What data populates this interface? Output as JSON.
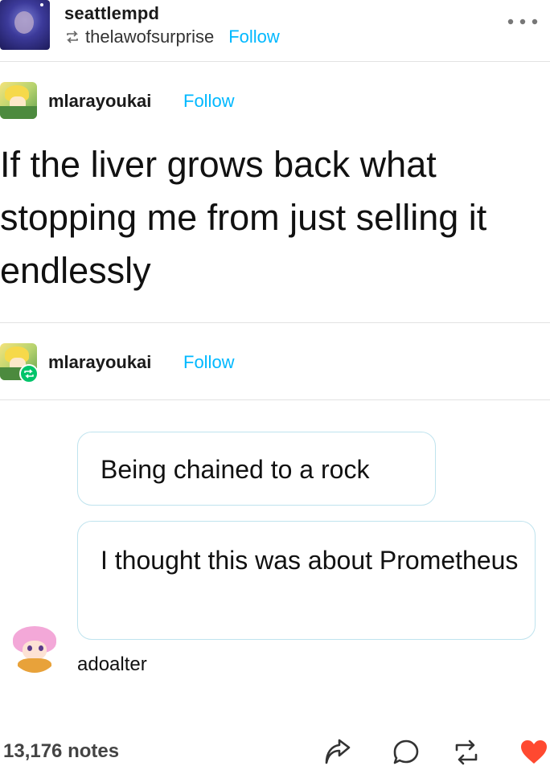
{
  "header": {
    "username": "seattlempd",
    "reblogged_from": "thelawofsurprise",
    "follow_label": "Follow",
    "more_icon": "more-horizontal-icon"
  },
  "trail": [
    {
      "username": "mlarayoukai",
      "follow_label": "Follow",
      "text": "If the liver grows back what stopping me from just selling it endlessly"
    },
    {
      "username": "mlarayoukai",
      "follow_label": "Follow",
      "badge_icon": "reblog-badge-icon"
    }
  ],
  "chat": {
    "bubbles": [
      "Being chained to a rock",
      "I thought this was about Prometheus"
    ],
    "asker": "adoalter"
  },
  "footer": {
    "notes": "13,176 notes",
    "actions": [
      "share-icon",
      "reply-icon",
      "reblog-icon",
      "like-icon"
    ],
    "like_color": "#ff4930",
    "accent_color": "#00b8ff"
  }
}
